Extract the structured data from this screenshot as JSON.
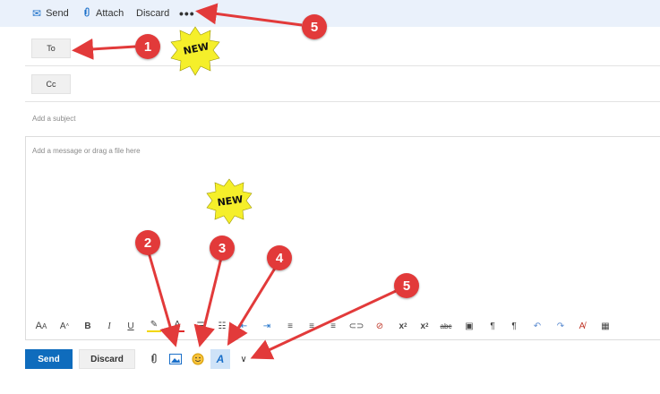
{
  "toolbar": {
    "send_label": "Send",
    "attach_label": "Attach",
    "discard_label": "Discard",
    "more_label": "•••"
  },
  "fields": {
    "to_label": "To",
    "cc_label": "Cc",
    "subject_placeholder": "Add a subject",
    "body_placeholder": "Add a message or drag a file here"
  },
  "format_bar": {
    "icons": [
      "font-size-icon",
      "grow-font-icon",
      "bold-icon",
      "italic-icon",
      "underline-icon",
      "highlight-icon",
      "font-color-icon",
      "bullets-icon",
      "numbering-icon",
      "decrease-indent-icon",
      "increase-indent-icon",
      "align-left-icon",
      "align-center-icon",
      "align-right-icon",
      "link-icon",
      "unlink-icon",
      "superscript-icon",
      "subscript-icon",
      "strikethrough-icon",
      "insert-image-icon",
      "ltr-icon",
      "rtl-icon",
      "undo-icon",
      "redo-icon",
      "clear-format-icon",
      "table-icon"
    ]
  },
  "actions": {
    "send_label": "Send",
    "discard_label": "Discard"
  },
  "callouts": {
    "badge1": "1",
    "badge2": "2",
    "badge3": "3",
    "badge4": "4",
    "badge5_top": "5",
    "badge5_bottom": "5",
    "new_label": "NEW"
  },
  "colors": {
    "accent": "#0f6cbd",
    "toolbar_bg": "#eaf1fb",
    "callout_red": "#e23a3a",
    "starburst": "#f5ef2a"
  }
}
